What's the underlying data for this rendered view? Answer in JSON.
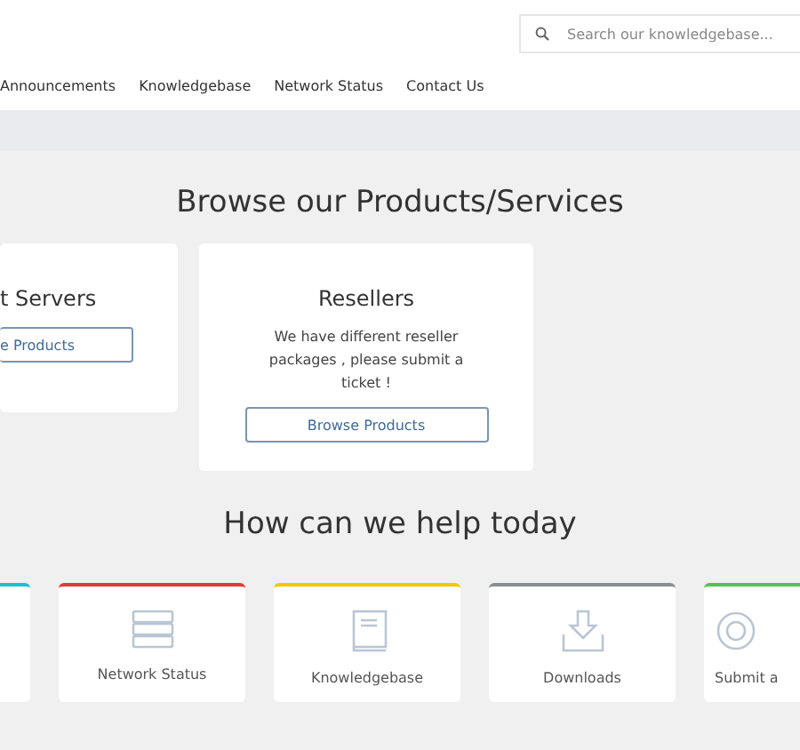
{
  "search": {
    "placeholder": "Search our knowledgebase..."
  },
  "nav": [
    "Announcements",
    "Knowledgebase",
    "Network Status",
    "Contact Us"
  ],
  "products": {
    "title": "Browse our Products/Services",
    "cards": [
      {
        "title": "t Servers",
        "button": "e Products"
      },
      {
        "title": "Resellers",
        "text": "We have different reseller packages , please submit a ticket !",
        "button": "Browse Products"
      }
    ]
  },
  "help": {
    "title": "How can we help today",
    "items": [
      {
        "kind": "blank",
        "color": "#17c3c9"
      },
      {
        "kind": "server",
        "label": "Network Status",
        "color": "#e53935"
      },
      {
        "kind": "book",
        "label": "Knowledgebase",
        "color": "#f7c600"
      },
      {
        "kind": "download",
        "label": "Downloads",
        "color": "#8a8f94"
      },
      {
        "kind": "lifebuoy",
        "label": "Submit a",
        "color": "#4cc552"
      }
    ]
  }
}
